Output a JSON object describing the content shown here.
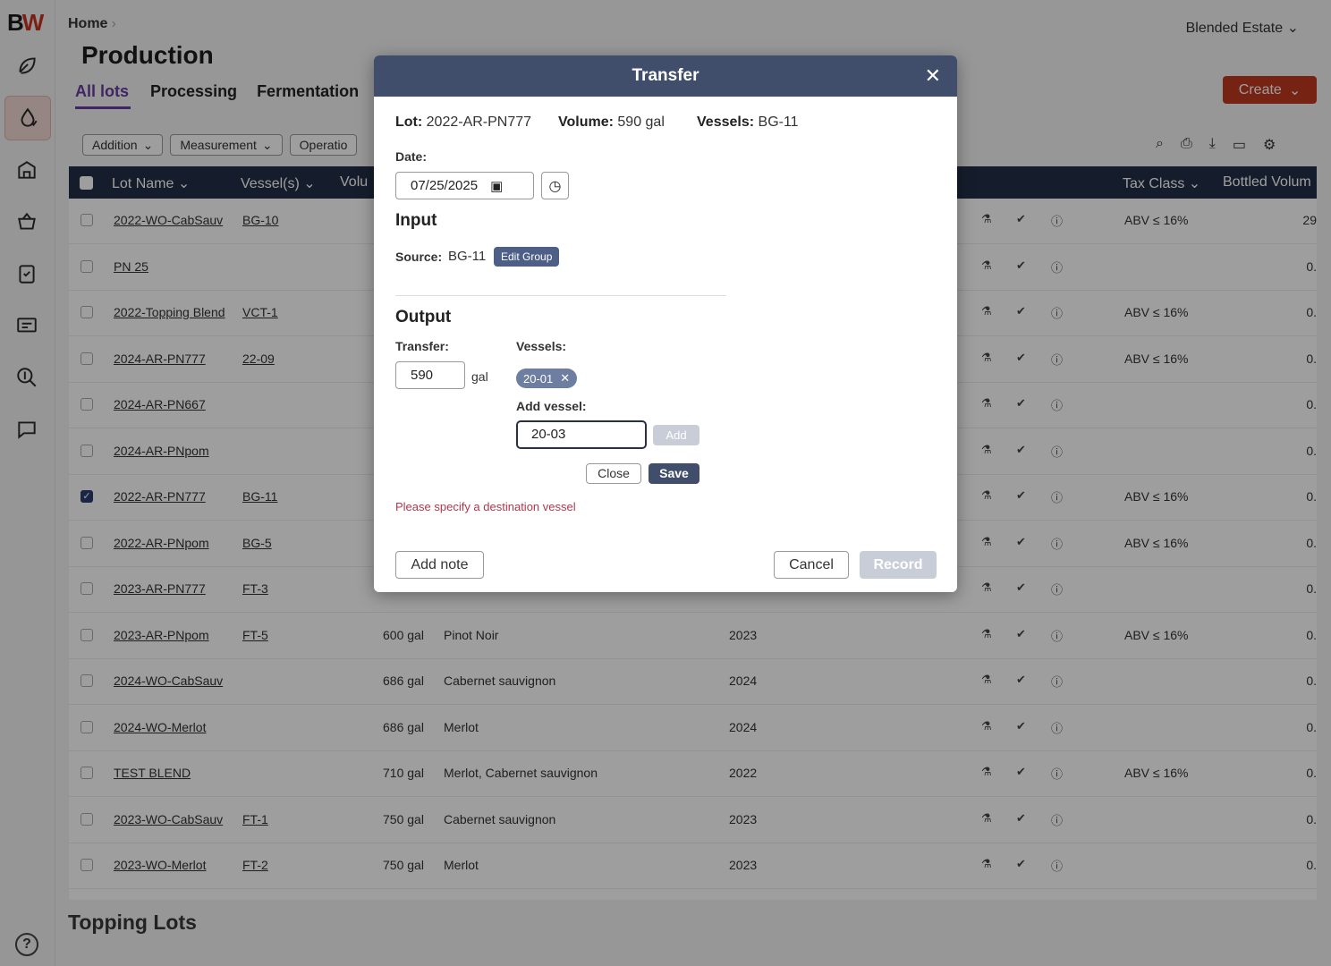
{
  "app": {
    "logo_a": "B",
    "logo_b": "W"
  },
  "header": {
    "breadcrumb": "Home",
    "title": "Production",
    "estate": "Blended Estate",
    "create_label": "Create"
  },
  "tabs": [
    {
      "label": "All lots"
    },
    {
      "label": "Processing"
    },
    {
      "label": "Fermentation"
    }
  ],
  "filters": [
    {
      "label": "Addition"
    },
    {
      "label": "Measurement"
    },
    {
      "label": "Operatio"
    }
  ],
  "table": {
    "columns": {
      "lot_name": "Lot Name",
      "vessels": "Vessel(s)",
      "volume": "Volu",
      "tax_class": "Tax Class",
      "bottled": "Bottled Volum"
    },
    "rows": [
      {
        "lot": "2022-WO-CabSauv",
        "vessel": "BG-10",
        "volume": "",
        "variety": "",
        "year": "",
        "tax": "ABV ≤ 16%",
        "bottled": "29",
        "checked": false
      },
      {
        "lot": "PN 25",
        "vessel": "",
        "volume": "",
        "variety": "",
        "year": "",
        "tax": "",
        "bottled": "0.",
        "checked": false
      },
      {
        "lot": "2022-Topping Blend",
        "vessel": "VCT-1",
        "volume": "",
        "variety": "",
        "year": "",
        "tax": "ABV ≤ 16%",
        "bottled": "0.",
        "checked": false
      },
      {
        "lot": "2024-AR-PN777",
        "vessel": "22-09",
        "volume": "",
        "variety": "",
        "year": "",
        "tax": "ABV ≤ 16%",
        "bottled": "0.",
        "checked": false
      },
      {
        "lot": "2024-AR-PN667",
        "vessel": "",
        "volume": "",
        "variety": "",
        "year": "",
        "tax": "",
        "bottled": "0.",
        "checked": false
      },
      {
        "lot": "2024-AR-PNpom",
        "vessel": "",
        "volume": "",
        "variety": "",
        "year": "",
        "tax": "",
        "bottled": "0.",
        "checked": false
      },
      {
        "lot": "2022-AR-PN777",
        "vessel": "BG-11",
        "volume": "",
        "variety": "",
        "year": "",
        "tax": "ABV ≤ 16%",
        "bottled": "0.",
        "checked": true
      },
      {
        "lot": "2022-AR-PNpom",
        "vessel": "BG-5",
        "volume": "",
        "variety": "",
        "year": "",
        "tax": "ABV ≤ 16%",
        "bottled": "0.",
        "checked": false
      },
      {
        "lot": "2023-AR-PN777",
        "vessel": "FT-3",
        "volume": "",
        "variety": "",
        "year": "",
        "tax": "",
        "bottled": "0.",
        "checked": false
      },
      {
        "lot": "2023-AR-PNpom",
        "vessel": "FT-5",
        "volume": "600 gal",
        "variety": "Pinot Noir",
        "year": "2023",
        "tax": "ABV ≤ 16%",
        "bottled": "0.",
        "checked": false
      },
      {
        "lot": "2024-WO-CabSauv",
        "vessel": "",
        "volume": "686 gal",
        "variety": "Cabernet sauvignon",
        "year": "2024",
        "tax": "",
        "bottled": "0.",
        "checked": false
      },
      {
        "lot": "2024-WO-Merlot",
        "vessel": "",
        "volume": "686 gal",
        "variety": "Merlot",
        "year": "2024",
        "tax": "",
        "bottled": "0.",
        "checked": false
      },
      {
        "lot": "TEST BLEND",
        "vessel": "",
        "volume": "710 gal",
        "variety": "Merlot, Cabernet sauvignon",
        "year": "2022",
        "tax": "ABV ≤ 16%",
        "bottled": "0.",
        "checked": false
      },
      {
        "lot": "2023-WO-CabSauv",
        "vessel": "FT-1",
        "volume": "750 gal",
        "variety": "Cabernet sauvignon",
        "year": "2023",
        "tax": "",
        "bottled": "0.",
        "checked": false
      },
      {
        "lot": "2023-WO-Merlot",
        "vessel": "FT-2",
        "volume": "750 gal",
        "variety": "Merlot",
        "year": "2023",
        "tax": "",
        "bottled": "0.",
        "checked": false
      }
    ]
  },
  "topping": {
    "title": "Topping Lots"
  },
  "modal": {
    "title": "Transfer",
    "lot_label": "Lot:",
    "lot_value": "2022-AR-PN777",
    "volume_label": "Volume:",
    "volume_value": "590 gal",
    "vessels_label": "Vessels:",
    "vessels_value": "BG-11",
    "date_label": "Date:",
    "date_value": "07/25/2025",
    "input_heading": "Input",
    "source_label": "Source:",
    "source_value": "BG-11",
    "edit_group": "Edit Group",
    "output_heading": "Output",
    "transfer_label": "Transfer:",
    "transfer_value": "590",
    "transfer_unit": "gal",
    "out_vessels_label": "Vessels:",
    "chip": "20-01",
    "add_vessel_label": "Add vessel:",
    "add_vessel_value": "20-03",
    "add_label": "Add",
    "close_label": "Close",
    "save_label": "Save",
    "error": "Please specify a destination vessel",
    "add_note": "Add note",
    "cancel": "Cancel",
    "record": "Record"
  },
  "icons": [
    "leaf-icon",
    "drop-icon",
    "building-icon",
    "basket-icon",
    "clipboard-icon",
    "report-icon",
    "dollar-search-icon",
    "chat-icon",
    "help-icon"
  ]
}
